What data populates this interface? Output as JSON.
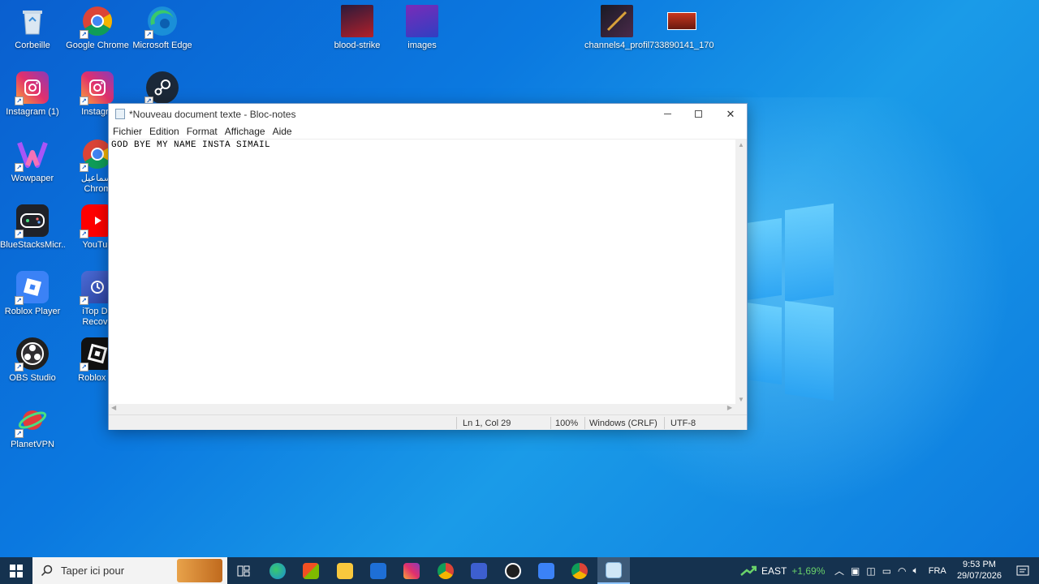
{
  "desktop": {
    "icons": [
      {
        "label": "Corbeille"
      },
      {
        "label": "Google Chrome"
      },
      {
        "label": "Microsoft Edge"
      },
      {
        "label": "blood-strike"
      },
      {
        "label": "images"
      },
      {
        "label": "channels4_profile"
      },
      {
        "label": "733890141_170..."
      },
      {
        "label": "Instagram (1)"
      },
      {
        "label": "Instagra"
      },
      {
        "label": "Wowpaper"
      },
      {
        "label": "إسماعيل\nChrom"
      },
      {
        "label": "BlueStacksMicr..."
      },
      {
        "label": "YouTub"
      },
      {
        "label": "Roblox Player"
      },
      {
        "label": "iTop Da\nRecove"
      },
      {
        "label": "OBS Studio"
      },
      {
        "label": "Roblox St"
      },
      {
        "label": "PlanetVPN"
      }
    ]
  },
  "notepad": {
    "title": "*Nouveau document texte - Bloc-notes",
    "menu": [
      "Fichier",
      "Edition",
      "Format",
      "Affichage",
      "Aide"
    ],
    "content": "GOD BYE MY NAME INSTA SIMAIL",
    "status": {
      "position": "Ln 1, Col 29",
      "zoom": "100%",
      "line_endings": "Windows (CRLF)",
      "encoding": "UTF-8"
    }
  },
  "taskbar": {
    "search_placeholder": "Taper ici pour",
    "tray": {
      "stock_name": "EAST",
      "stock_change": "+1,69%",
      "language": "FRA",
      "time": "9:53 PM",
      "date": "29/07/2026"
    }
  },
  "colors": {
    "taskbar": "#15324f",
    "desktop": "#0b79e0",
    "stock_positive": "#6ad26a"
  }
}
